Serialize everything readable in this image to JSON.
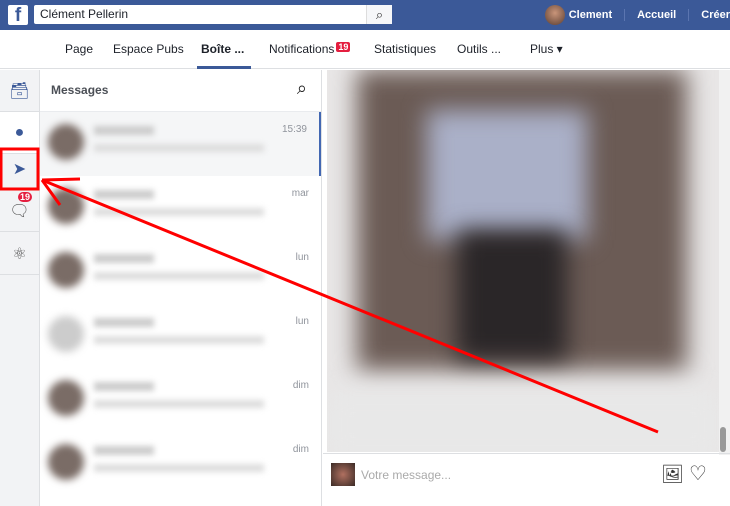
{
  "topbar": {
    "search_value": "Clément Pellerin",
    "user": "Clement",
    "links": [
      "Accueil",
      "Créer"
    ]
  },
  "nav": {
    "items": [
      "Page",
      "Espace Pubs",
      "Boîte ...",
      "Notifications",
      "Statistiques",
      "Outils ...",
      "Plus ▾"
    ],
    "notifications_badge": "19",
    "active": "Boîte ..."
  },
  "rail": {
    "badge": "19"
  },
  "conversations": {
    "title": "Messages",
    "times": [
      "15:39",
      "mar",
      "lun",
      "lun",
      "dim",
      "dim"
    ]
  },
  "composer": {
    "placeholder": "Votre message..."
  },
  "colors": {
    "brand": "#3b5998",
    "annotation": "#ff0000"
  }
}
